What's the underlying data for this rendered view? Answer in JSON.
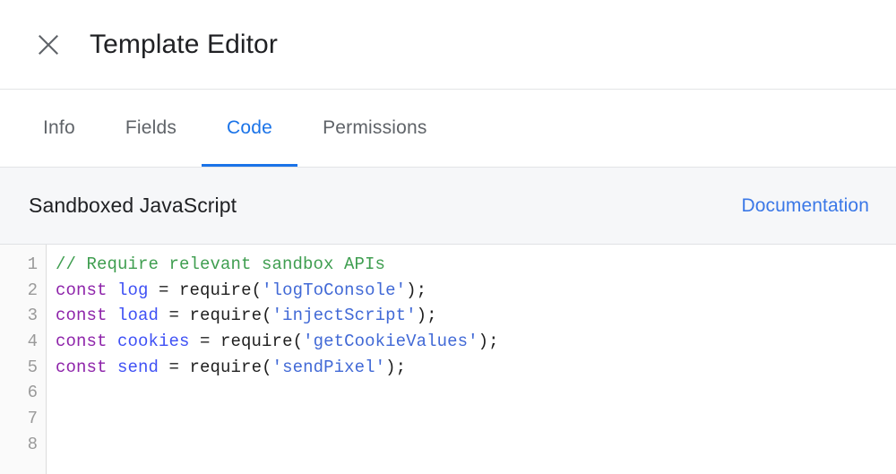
{
  "header": {
    "title": "Template Editor",
    "close_icon": "close-icon"
  },
  "tabs": [
    {
      "label": "Info",
      "active": false
    },
    {
      "label": "Fields",
      "active": false
    },
    {
      "label": "Code",
      "active": true
    },
    {
      "label": "Permissions",
      "active": false
    }
  ],
  "section": {
    "title": "Sandboxed JavaScript",
    "doc_link": "Documentation"
  },
  "colors": {
    "accent": "#1a73e8",
    "link": "#3b78e7",
    "tab_inactive": "#5f6368",
    "title": "#202124",
    "section_bg": "#f6f7f9",
    "gutter_bg": "#fafafa",
    "comment": "#3f9e50",
    "keyword": "#8e24aa",
    "variable": "#3f51f5",
    "string": "#4169d6",
    "plain": "#1f1f1f"
  },
  "editor": {
    "line_numbers": [
      "1",
      "2",
      "3",
      "4",
      "5",
      "6",
      "7",
      "8"
    ],
    "lines": [
      {
        "n": "1",
        "tokens": [
          {
            "t": "comment",
            "v": "// Require relevant sandbox APIs"
          }
        ]
      },
      {
        "n": "2",
        "tokens": [
          {
            "t": "keyword",
            "v": "const"
          },
          {
            "t": "plain",
            "v": " "
          },
          {
            "t": "var",
            "v": "log"
          },
          {
            "t": "plain",
            "v": " = require("
          },
          {
            "t": "string",
            "v": "'logToConsole'"
          },
          {
            "t": "plain",
            "v": ");"
          }
        ]
      },
      {
        "n": "3",
        "tokens": [
          {
            "t": "keyword",
            "v": "const"
          },
          {
            "t": "plain",
            "v": " "
          },
          {
            "t": "var",
            "v": "load"
          },
          {
            "t": "plain",
            "v": " = require("
          },
          {
            "t": "string",
            "v": "'injectScript'"
          },
          {
            "t": "plain",
            "v": ");"
          }
        ]
      },
      {
        "n": "4",
        "tokens": [
          {
            "t": "keyword",
            "v": "const"
          },
          {
            "t": "plain",
            "v": " "
          },
          {
            "t": "var",
            "v": "cookies"
          },
          {
            "t": "plain",
            "v": " = require("
          },
          {
            "t": "string",
            "v": "'getCookieValues'"
          },
          {
            "t": "plain",
            "v": ");"
          }
        ]
      },
      {
        "n": "5",
        "tokens": [
          {
            "t": "keyword",
            "v": "const"
          },
          {
            "t": "plain",
            "v": " "
          },
          {
            "t": "var",
            "v": "send"
          },
          {
            "t": "plain",
            "v": " = require("
          },
          {
            "t": "string",
            "v": "'sendPixel'"
          },
          {
            "t": "plain",
            "v": ");"
          }
        ]
      },
      {
        "n": "6",
        "tokens": []
      },
      {
        "n": "7",
        "tokens": []
      },
      {
        "n": "8",
        "tokens": []
      }
    ]
  }
}
